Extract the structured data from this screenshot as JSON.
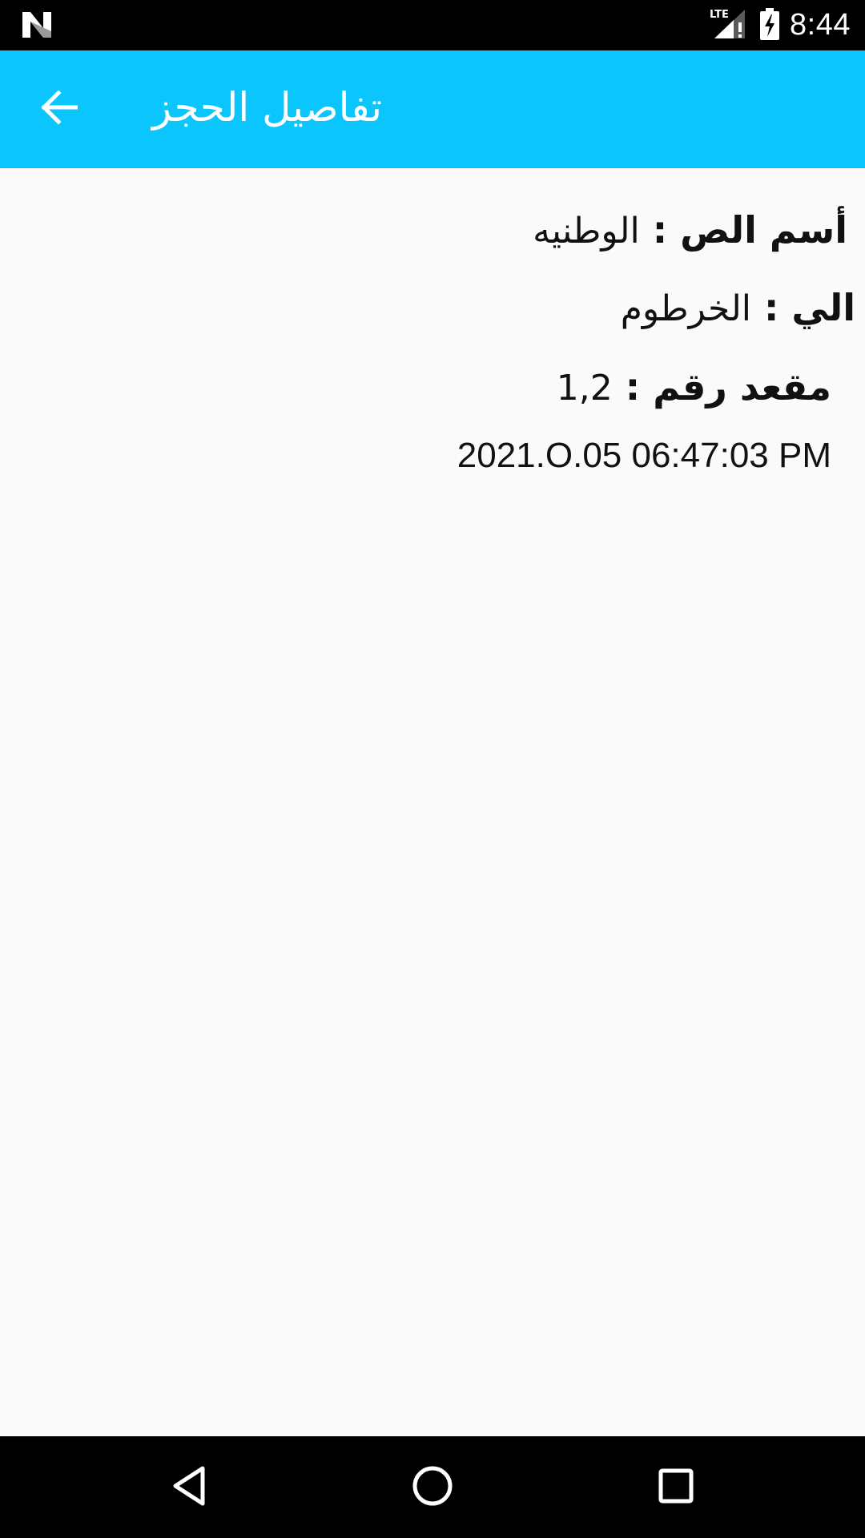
{
  "status_bar": {
    "time": "8:44",
    "network": "LTE",
    "icons": [
      "n-logo-icon",
      "lte-signal-icon",
      "battery-charging-icon"
    ]
  },
  "app_bar": {
    "title": "تفاصيل الحجز",
    "back_icon": "arrow-back-icon",
    "color": "#0bc6fd"
  },
  "details": {
    "rows": [
      {
        "label": "أسم الص",
        "colon": ":",
        "value": "الوطنيه"
      },
      {
        "label": "الي",
        "colon": ":",
        "value": "الخرطوم"
      },
      {
        "label": "مقعد رقم",
        "colon": ":",
        "value": "1,2"
      }
    ],
    "timestamp": "2021.O.05 06:47:03 PM"
  },
  "nav_bar": {
    "buttons": [
      "back-triangle-icon",
      "home-circle-icon",
      "recents-square-icon"
    ]
  }
}
